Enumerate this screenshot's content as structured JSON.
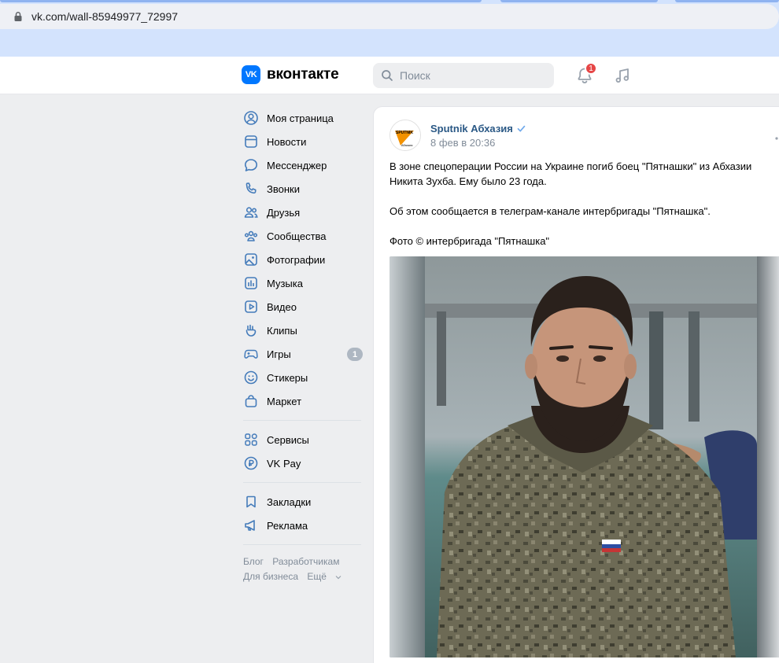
{
  "browser": {
    "url": "vk.com/wall-85949977_72997"
  },
  "header": {
    "logo_mark": "VK",
    "logo_text": "вконтакте",
    "search_placeholder": "Поиск",
    "notifications_count": "1"
  },
  "sidebar": {
    "items": [
      {
        "label": "Моя страница",
        "icon": "user-icon"
      },
      {
        "label": "Новости",
        "icon": "newsfeed-icon"
      },
      {
        "label": "Мессенджер",
        "icon": "message-icon"
      },
      {
        "label": "Звонки",
        "icon": "phone-icon"
      },
      {
        "label": "Друзья",
        "icon": "friends-icon"
      },
      {
        "label": "Сообщества",
        "icon": "communities-icon"
      },
      {
        "label": "Фотографии",
        "icon": "photo-icon"
      },
      {
        "label": "Музыка",
        "icon": "music-icon"
      },
      {
        "label": "Видео",
        "icon": "video-icon"
      },
      {
        "label": "Клипы",
        "icon": "clips-icon"
      },
      {
        "label": "Игры",
        "icon": "games-icon",
        "counter": "1"
      },
      {
        "label": "Стикеры",
        "icon": "smile-icon"
      },
      {
        "label": "Маркет",
        "icon": "market-icon"
      }
    ],
    "items2": [
      {
        "label": "Сервисы",
        "icon": "services-icon"
      },
      {
        "label": "VK Pay",
        "icon": "vkpay-icon"
      }
    ],
    "items3": [
      {
        "label": "Закладки",
        "icon": "bookmark-icon"
      },
      {
        "label": "Реклама",
        "icon": "megaphone-icon"
      }
    ],
    "footer": {
      "blog": "Блог",
      "developers": "Разработчикам",
      "business": "Для бизнеса",
      "more": "Ещё"
    }
  },
  "post": {
    "author": "Sputnik Абхазия",
    "avatar_text": "SPUTNIK",
    "avatar_sub": "Абхазия",
    "date": "8 фев в 20:36",
    "paragraphs": [
      "В зоне спецоперации России на Украине погиб боец \"Пятнашки\" из Абхазии Никита Зухба. Ему было 23 года.",
      "Об этом сообщается в телеграм-канале интербригады \"Пятнашка\".",
      "Фото © интербригада \"Пятнашка\""
    ]
  },
  "colors": {
    "vk_blue": "#0077ff",
    "link": "#2a5885",
    "badge_red": "#e64646",
    "sputnik_orange": "#f39200"
  }
}
